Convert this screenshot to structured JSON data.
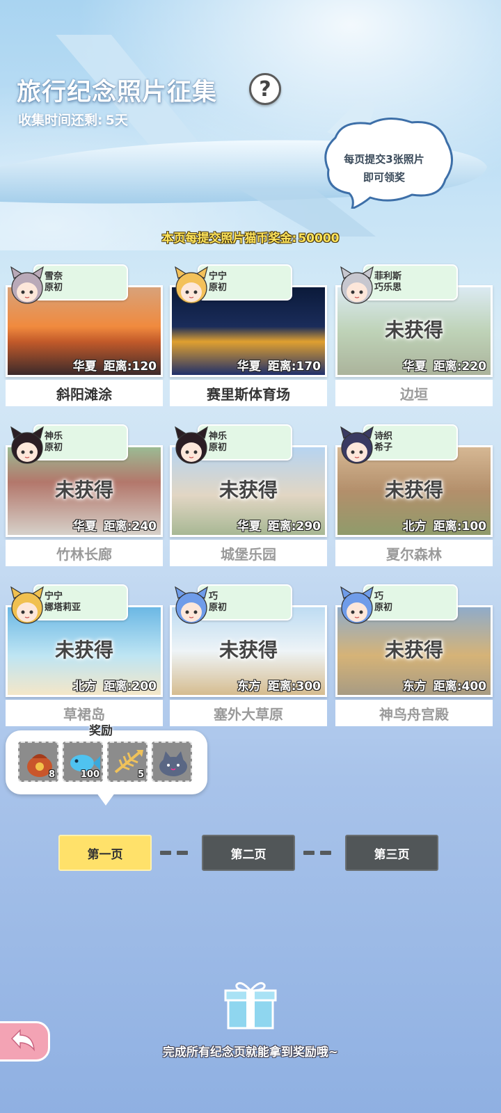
{
  "header": {
    "title": "旅行纪念照片征集",
    "help_icon": "?",
    "countdown_label": "收集时间还剩:",
    "countdown_value": "5天"
  },
  "hint_bubble": {
    "line1": "每页提交3张照片",
    "line2": "即可领奖"
  },
  "bonus": {
    "label": "本页每提交照片猫币奖金:",
    "amount": "50000"
  },
  "cards": [
    {
      "char_name": "雪奈",
      "char_outfit": "原初",
      "region": "华夏",
      "distance": "距离:120",
      "place": "斜阳滩涂",
      "obtained": true,
      "lock_text": ""
    },
    {
      "char_name": "宁宁",
      "char_outfit": "原初",
      "region": "华夏",
      "distance": "距离:170",
      "place": "赛里斯体育场",
      "obtained": true,
      "lock_text": ""
    },
    {
      "char_name": "菲利斯",
      "char_outfit": "巧乐思",
      "region": "华夏",
      "distance": "距离:220",
      "place": "边垣",
      "obtained": false,
      "lock_text": "未获得"
    },
    {
      "char_name": "神乐",
      "char_outfit": "原初",
      "region": "华夏",
      "distance": "距离:240",
      "place": "竹林长廊",
      "obtained": false,
      "lock_text": "未获得"
    },
    {
      "char_name": "神乐",
      "char_outfit": "原初",
      "region": "华夏",
      "distance": "距离:290",
      "place": "城堡乐园",
      "obtained": false,
      "lock_text": "未获得"
    },
    {
      "char_name": "诗织",
      "char_outfit": "希子",
      "region": "北方",
      "distance": "距离:100",
      "place": "夏尔森林",
      "obtained": false,
      "lock_text": "未获得"
    },
    {
      "char_name": "宁宁",
      "char_outfit": "娜塔莉亚",
      "region": "北方",
      "distance": "距离:200",
      "place": "草裙岛",
      "obtained": false,
      "lock_text": "未获得"
    },
    {
      "char_name": "巧",
      "char_outfit": "原初",
      "region": "东方",
      "distance": "距离:300",
      "place": "塞外大草原",
      "obtained": false,
      "lock_text": "未获得"
    },
    {
      "char_name": "巧",
      "char_outfit": "原初",
      "region": "东方",
      "distance": "距离:400",
      "place": "神鸟舟宫殿",
      "obtained": false,
      "lock_text": "未获得"
    }
  ],
  "reward": {
    "title": "奖励",
    "items": [
      {
        "icon": "treasure-bag-icon",
        "qty": "8"
      },
      {
        "icon": "fish-icon",
        "qty": "100"
      },
      {
        "icon": "fish-bone-icon",
        "qty": "5"
      },
      {
        "icon": "cat-plush-icon",
        "qty": ""
      }
    ]
  },
  "pagination": {
    "pages": [
      "第一页",
      "第二页",
      "第三页"
    ],
    "active_index": 0
  },
  "footer": {
    "hint": "完成所有纪念页就能拿到奖励哦~",
    "gift_icon": "gift-icon",
    "back_icon": "back-arrow-icon"
  },
  "colors": {
    "active_page": "#ffe16a",
    "inactive_page": "#515658",
    "tag_bg": "#e3f7e6",
    "bonus_text": "#ffe45a"
  }
}
